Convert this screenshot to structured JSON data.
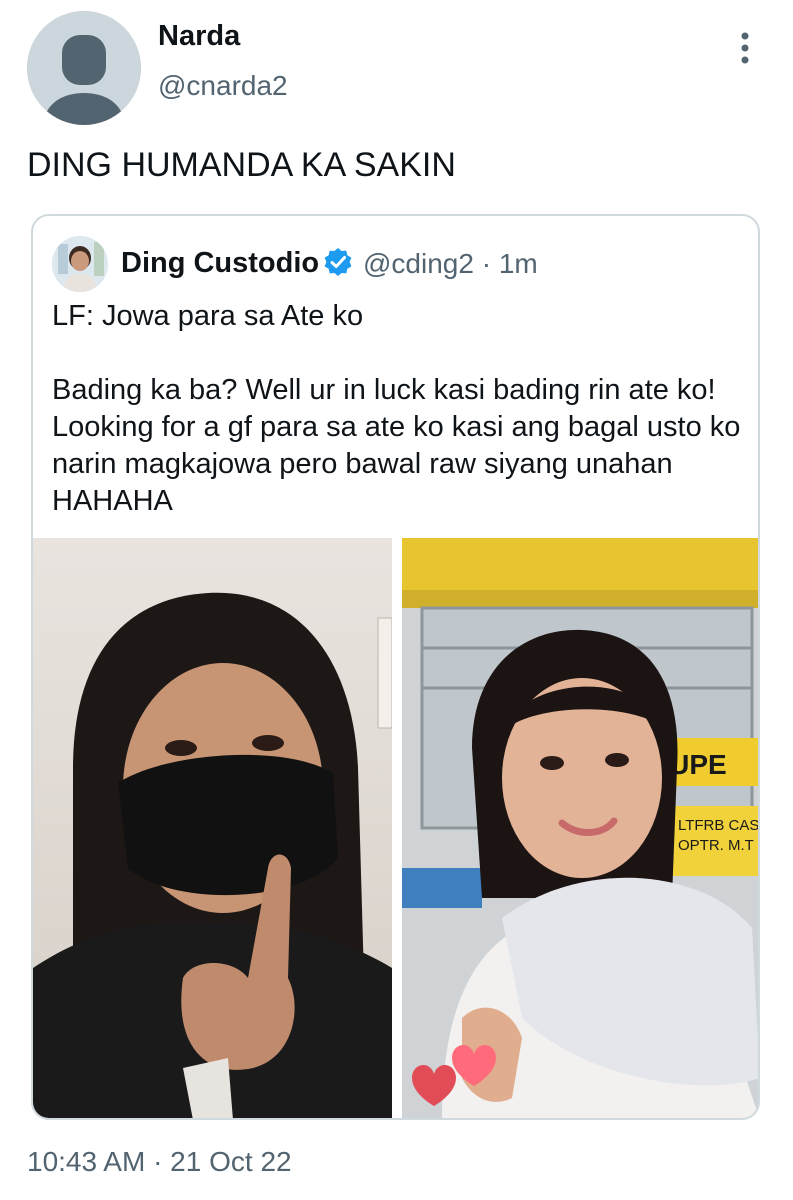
{
  "tweet": {
    "author_name": "Narda",
    "author_handle": "@cnarda2",
    "text": "DING HUMANDA KA SAKIN",
    "timestamp": "10:43 AM · 21 Oct 22",
    "more_icon": "more-vertical-icon"
  },
  "quoted_tweet": {
    "author_name": "Ding Custodio",
    "verified_icon": "verified-badge-icon",
    "author_handle": "@cding2",
    "separator": "·",
    "time": "1m",
    "paragraphs": [
      "LF: Jowa para sa Ate ko",
      "Bading ka ba? Well ur in luck kasi bading rin ate ko! Looking for a gf para sa ate ko kasi ang bagal usto ko narin magkajowa pero bawal raw siyang unahan HAHAHA"
    ],
    "photo_signs": {
      "sign_top": "LUPE",
      "sign_bottom_1": "LTFRB CAS",
      "sign_bottom_2": "OPTR. M.T"
    }
  },
  "colors": {
    "text": "#0f1419",
    "secondary": "#536471",
    "border": "#cfd9de",
    "verified": "#1d9bf0",
    "placeholder_avatar": "#ccd6dd"
  }
}
